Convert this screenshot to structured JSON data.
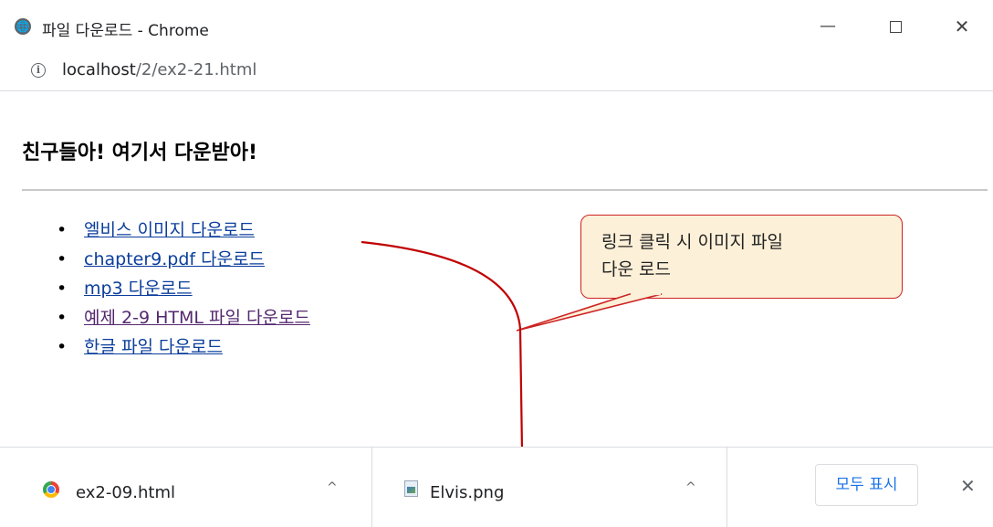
{
  "window": {
    "title": "파일 다운로드 - Chrome",
    "minimize_label": "—",
    "close_label": "✕"
  },
  "address": {
    "host": "localhost",
    "path": "/2/ex2-21.html"
  },
  "page": {
    "heading": "친구들아! 여기서 다운받아!",
    "links": [
      {
        "label": "엘비스 이미지 다운로드",
        "visited": false
      },
      {
        "label": "chapter9.pdf 다운로드",
        "visited": false
      },
      {
        "label": "mp3 다운로드",
        "visited": false
      },
      {
        "label": "예제 2-9 HTML 파일 다운로드",
        "visited": true
      },
      {
        "label": "한글 파일 다운로드",
        "visited": false
      }
    ]
  },
  "callout": {
    "line1": "링크 클릭 시 이미지 파일",
    "line2": "다운 로드"
  },
  "downloads": {
    "items": [
      {
        "name": "ex2-09.html",
        "icon": "chrome-icon"
      },
      {
        "name": "Elvis.png",
        "icon": "image-file-icon"
      }
    ],
    "chevron": "^",
    "show_all_label": "모두 표시",
    "close_label": "✕"
  },
  "colors": {
    "link": "#0b3e9c",
    "visited_link": "#54286f",
    "callout_fill": "#fdf0d8",
    "callout_border": "#cc2222",
    "arrow": "#c00000"
  }
}
